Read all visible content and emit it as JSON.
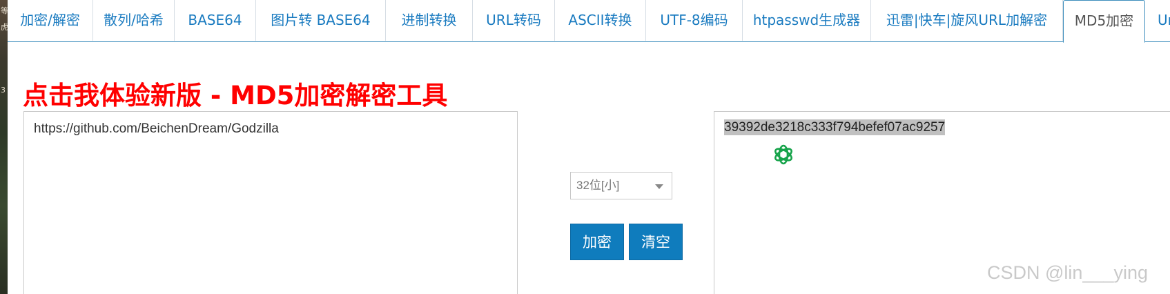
{
  "left_strip": {
    "chars": [
      "等",
      "虎",
      "3"
    ]
  },
  "tabs": [
    {
      "label": "加密/解密"
    },
    {
      "label": "散列/哈希"
    },
    {
      "label": "BASE64"
    },
    {
      "label": "图片转 BASE64"
    },
    {
      "label": "进制转换"
    },
    {
      "label": "URL转码"
    },
    {
      "label": "ASCII转换"
    },
    {
      "label": "UTF-8编码"
    },
    {
      "label": "htpasswd生成器"
    },
    {
      "label": "迅雷|快车|旋风URL加解密"
    },
    {
      "label": "MD5加密",
      "active": true
    },
    {
      "label": "Uni"
    }
  ],
  "headline": "点击我体验新版 - MD5加密解密工具",
  "input": {
    "value": "https://github.com/BeichenDream/Godzilla"
  },
  "output": {
    "value": "39392de3218c333f794befef07ac9257"
  },
  "mode_select": {
    "selected": "32位[小]"
  },
  "buttons": {
    "encrypt": "加密",
    "clear": "清空"
  },
  "overlay_icon": {
    "name": "chatgpt-logo-icon",
    "color": "#16a34a"
  },
  "watermark": "CSDN @lin___ying",
  "colors": {
    "accent": "#0f7cbd",
    "tab_text": "#1a7bc0",
    "headline": "#ff0000"
  }
}
